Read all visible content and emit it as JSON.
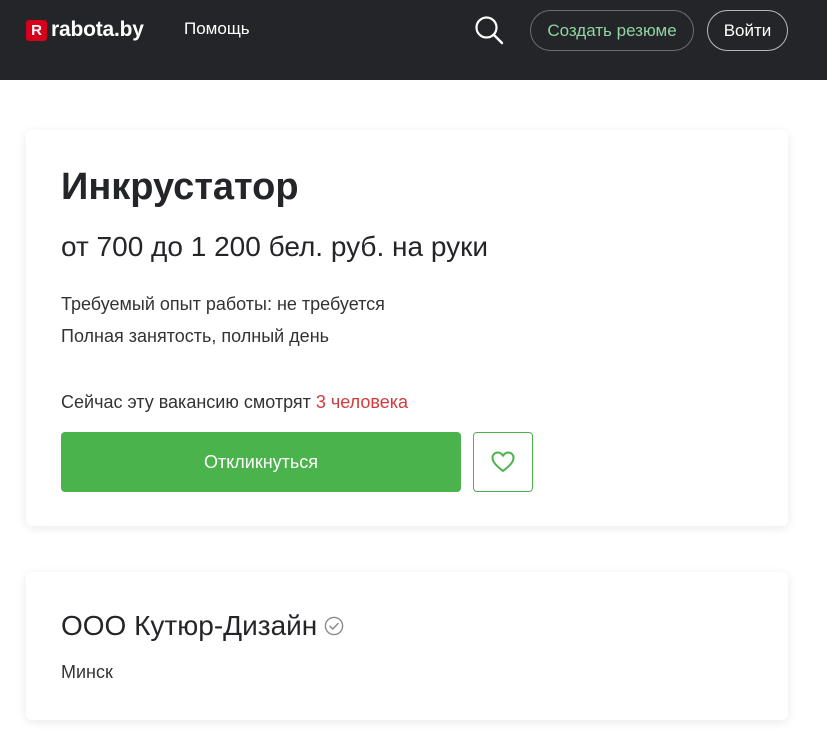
{
  "header": {
    "logo_mark": "R",
    "logo_text": "rabota.by",
    "help_label": "Помощь",
    "create_resume_label": "Создать резюме",
    "login_label": "Войти"
  },
  "vacancy": {
    "title": "Инкрустатор",
    "salary": "от 700 до 1 200 бел. руб. на руки",
    "experience": "Требуемый опыт работы: не требуется",
    "employment": "Полная занятость, полный день",
    "watching_prefix": "Сейчас эту вакансию смотрят ",
    "watching_count": "3 человека",
    "apply_label": "Откликнуться",
    "favorite_icon": "heart-icon"
  },
  "company": {
    "name": "ООО Кутюр-Дизайн",
    "verified_icon": "check-circle-icon",
    "city": "Минск"
  },
  "colors": {
    "header_bg": "#232529",
    "brand_red": "#d6001c",
    "accent_green": "#4bb34b",
    "resume_text": "#8fd5a0",
    "watch_count_red": "#d23b3b"
  }
}
